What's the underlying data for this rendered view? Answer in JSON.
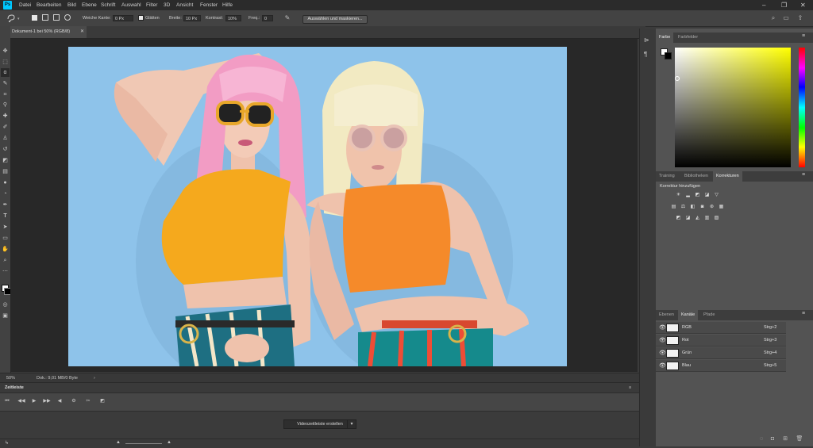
{
  "app": {
    "logo": "Ps"
  },
  "menu": {
    "items": [
      "Datei",
      "Bearbeiten",
      "Bild",
      "Ebene",
      "Schrift",
      "Auswahl",
      "Filter",
      "3D",
      "Ansicht",
      "Fenster",
      "Hilfe"
    ]
  },
  "window_controls": {
    "minimize": "–",
    "restore": "❐",
    "close": "✕"
  },
  "options": {
    "feather_label": "Weiche Kante:",
    "feather_value": "0 Px",
    "antialias_label": "Glätten",
    "width_label": "Breite:",
    "width_value": "10 Px",
    "contrast_label": "Kontrast:",
    "contrast_value": "10%",
    "frequency_label": "Freq.:",
    "frequency_value": "0",
    "select_mask_button": "Auswählen und maskieren..."
  },
  "document": {
    "tab_title": "Dokument-1 bei 50% (RGB/8)",
    "zoom": "50%",
    "doc_info": "Dok.: 9,01 MB/0 Byte"
  },
  "timeline": {
    "title": "Zeitleiste",
    "create_video_button": "Videozeitleiste erstellen"
  },
  "panels": {
    "color_tabs": [
      "Farbe",
      "Farbfelder"
    ],
    "adjust_tabs": [
      "Training",
      "Bibliotheken",
      "Korrekturen"
    ],
    "adjust_title": "Korrektur hinzufügen",
    "layer_tabs": [
      "Ebenen",
      "Kanäle",
      "Pfade"
    ]
  },
  "channels": [
    {
      "name": "RGB",
      "key": "Strg+2"
    },
    {
      "name": "Rot",
      "key": "Strg+3"
    },
    {
      "name": "Grün",
      "key": "Strg+4"
    },
    {
      "name": "Blau",
      "key": "Strg+5"
    }
  ],
  "colors": {
    "photo_background": "#89bfe6",
    "accent": "#00c8ff"
  }
}
